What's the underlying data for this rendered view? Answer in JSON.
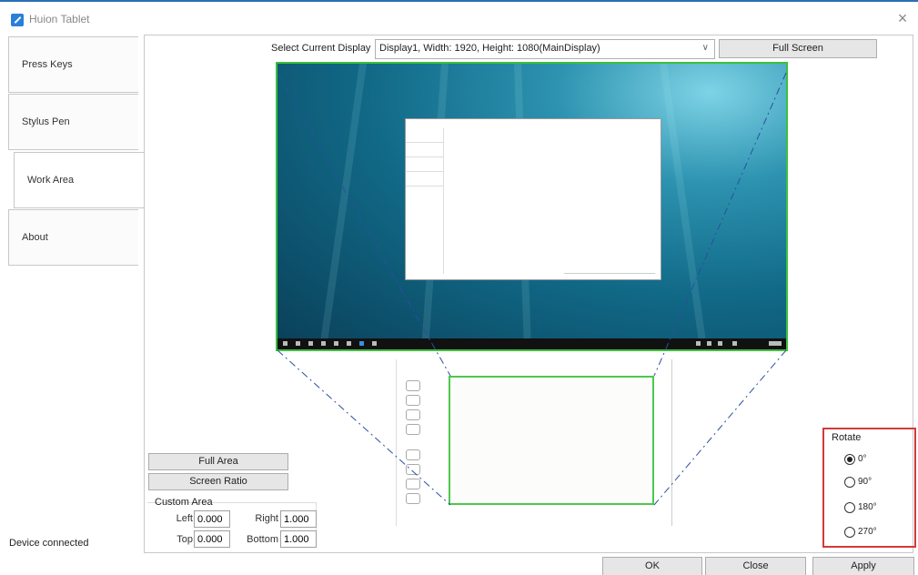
{
  "window": {
    "title": "Huion Tablet"
  },
  "sidebar": {
    "items": [
      {
        "label": "Press Keys"
      },
      {
        "label": "Stylus Pen"
      },
      {
        "label": "Work Area"
      },
      {
        "label": "About"
      }
    ]
  },
  "display": {
    "select_label": "Select Current Display",
    "selected": "Display1, Width: 1920, Height: 1080(MainDisplay)",
    "full_screen_label": "Full Screen"
  },
  "area_buttons": {
    "full_area": "Full Area",
    "screen_ratio": "Screen Ratio"
  },
  "custom_area": {
    "title": "Custom Area",
    "left_label": "Left",
    "left_value": "0.000",
    "right_label": "Right",
    "right_value": "1.000",
    "top_label": "Top",
    "top_value": "0.000",
    "bottom_label": "Bottom",
    "bottom_value": "1.000"
  },
  "rotate": {
    "title": "Rotate",
    "options": [
      "0°",
      "90°",
      "180°",
      "270°"
    ],
    "selected": "0°"
  },
  "status": {
    "text": "Device connected"
  },
  "footer": {
    "ok": "OK",
    "close": "Close",
    "apply": "Apply"
  },
  "colors": {
    "work_area_border": "#4cc94c",
    "rotate_highlight": "#d33a3a",
    "accent": "#2a6fb5"
  }
}
